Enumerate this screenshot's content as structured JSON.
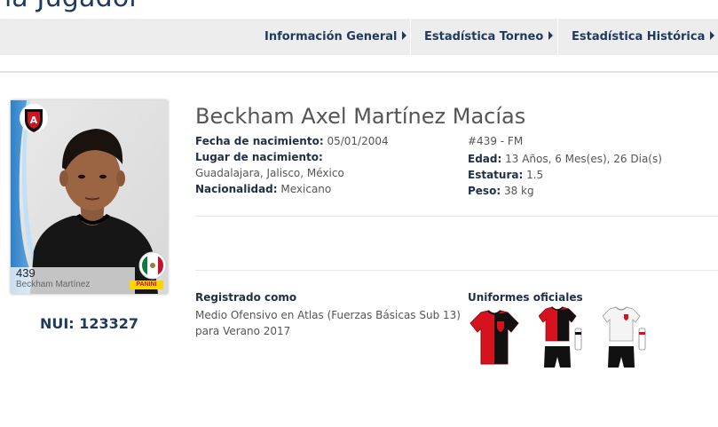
{
  "header": {
    "title": "na Jugador"
  },
  "nav": {
    "items": [
      {
        "label": "Información General"
      },
      {
        "label": "Estadística Torneo"
      },
      {
        "label": "Estadística Histórica"
      }
    ]
  },
  "card": {
    "number": "439",
    "name": "Beckham Martínez",
    "brand": "PANINI",
    "nui": "NUI: 123327"
  },
  "player": {
    "full_name": "Beckham Axel Martínez Macías",
    "birth_date_label": "Fecha de nacimiento:",
    "birth_date": "05/01/2004",
    "birth_place_label": "Lugar de nacimiento:",
    "birth_place": "Guadalajara, Jalisco, México",
    "nationality_label": "Nacionalidad:",
    "nationality": "Mexicano",
    "number_position": "#439 - FM",
    "age_label": "Edad:",
    "age": "13 Años, 6 Mes(es), 26 Dia(s)",
    "height_label": "Estatura:",
    "height": "1.5",
    "weight_label": "Peso:",
    "weight": "38 kg"
  },
  "registration": {
    "label": "Registrado como",
    "text": "Medio Ofensivo en Atlas (Fuerzas Básicas Sub 13) para Verano 2017"
  },
  "uniforms": {
    "label": "Uniformes oficiales",
    "colors": {
      "red": "#d7121f",
      "black": "#111111",
      "white": "#f4f4f4"
    }
  },
  "colors": {
    "navy": "#1e3a5f",
    "nav_bg": "#ededed",
    "accent_blue": "#2a7fc9"
  }
}
